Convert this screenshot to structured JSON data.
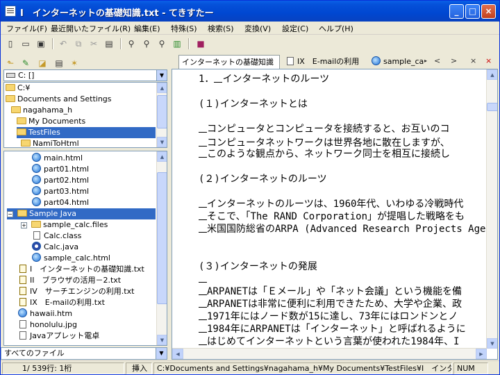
{
  "window": {
    "title": "I　インターネットの基礎知識.txt - てきすたー"
  },
  "titlebar_buttons": {
    "minimize": "_",
    "maximize": "□",
    "close": "×"
  },
  "menu": [
    "ファイル(F)",
    "最近開いたファイル(R)",
    "編集(E)",
    "特殊(S)",
    "検索(S)",
    "変換(V)",
    "設定(C)",
    "ヘルプ(H)"
  ],
  "drive": {
    "label": "C: []"
  },
  "folders": [
    "C:¥",
    "Documents and Settings",
    "nagahama_h",
    "My Documents",
    "TestFiles",
    "NamiToHtml"
  ],
  "files": [
    {
      "name": "main.html",
      "type": "ie"
    },
    {
      "name": "part01.html",
      "type": "ie"
    },
    {
      "name": "part02.html",
      "type": "ie"
    },
    {
      "name": "part03.html",
      "type": "ie"
    },
    {
      "name": "part04.html",
      "type": "ie"
    },
    {
      "name": "Sample Java",
      "type": "folder"
    },
    {
      "name": "sample_calc.files",
      "type": "folder"
    },
    {
      "name": "Calc.class",
      "type": "doc"
    },
    {
      "name": "Calc.java",
      "type": "java"
    },
    {
      "name": "sample_calc.html",
      "type": "ie"
    },
    {
      "name": "I　インターネットの基礎知識.txt",
      "type": "txt"
    },
    {
      "name": "II　ブラウザの活用－2.txt",
      "type": "txt"
    },
    {
      "name": "IV　サーチエンジンの利用.txt",
      "type": "txt"
    },
    {
      "name": "IX　E-mailの利用.txt",
      "type": "txt"
    },
    {
      "name": "hawaii.htm",
      "type": "ie"
    },
    {
      "name": "honolulu.jpg",
      "type": "doc"
    },
    {
      "name": "Javaアプレット電卓",
      "type": "doc"
    }
  ],
  "filter": {
    "value": "すべてのファイル"
  },
  "tabs": [
    "インターネットの基礎知識",
    "IX　E-mailの利用",
    "sample_cal"
  ],
  "tab_nav": {
    "prev": "<",
    "next": ">",
    "close": "×"
  },
  "editor_lines": [
    {
      "text": "1．",
      "u": true,
      "rest": "インターネットのルーツ",
      "indent": 1
    },
    {
      "text": "",
      "u": false,
      "rest": "",
      "indent": 0
    },
    {
      "text": "(１)インターネットとは",
      "u": false,
      "rest": "",
      "indent": 0
    },
    {
      "text": "",
      "u": false,
      "rest": "",
      "indent": 0
    },
    {
      "text": "",
      "u": true,
      "rest": "コンピュータとコンピュータを接続すると、お互いのコ",
      "indent": 0
    },
    {
      "text": "",
      "u": true,
      "rest": "コンピュータネットワークは世界各地に散在しますが、",
      "indent": 0
    },
    {
      "text": "",
      "u": true,
      "rest": "このような観点から、ネットワーク同士を相互に接続し",
      "indent": 0
    },
    {
      "text": "",
      "u": false,
      "rest": "",
      "indent": 0
    },
    {
      "text": "(２)インターネットのルーツ",
      "u": false,
      "rest": "",
      "indent": 0
    },
    {
      "text": "",
      "u": false,
      "rest": "",
      "indent": 0
    },
    {
      "text": "",
      "u": true,
      "rest": "インターネットのルーツは、1960年代、いわゆる冷戦時代",
      "indent": 0
    },
    {
      "text": "",
      "u": true,
      "rest": "そこで、「The RAND Corporation」が提唱した戦略をも",
      "indent": 0
    },
    {
      "text": "",
      "u": true,
      "rest": "米国国防総省のARPA (Advanced Research Projects Agen",
      "indent": 0
    },
    {
      "text": "",
      "u": false,
      "rest": "",
      "indent": 0
    },
    {
      "text": "(３)インターネットの発展",
      "u": false,
      "rest": "",
      "indent": 0
    },
    {
      "text": "",
      "u": true,
      "rest": "",
      "indent": 0
    },
    {
      "text": "",
      "u": true,
      "rest": "ARPANETは「Ｅメール」や「ネット会議」という機能を備",
      "indent": 0
    },
    {
      "text": "",
      "u": true,
      "rest": "ARPANETは非常に便利に利用できたため、大学や企業、政",
      "indent": 0
    },
    {
      "text": "",
      "u": true,
      "rest": "1971年にはノード数が15に達し、73年にはロンドンとノ",
      "indent": 0
    },
    {
      "text": "",
      "u": true,
      "rest": "1984年にARPANETは「インターネット」と呼ばれるように",
      "indent": 0
    },
    {
      "text": "",
      "u": true,
      "rest": "はじめてインターネットという言葉が使われた1984年、I",
      "indent": 0
    }
  ],
  "status": {
    "position": "1/ 539行: 1桁",
    "mode": "挿入",
    "path": "C:¥Documents and Settings¥nagahama_h¥My Documents¥TestFiles¥I　インタ",
    "num": "NUM"
  }
}
